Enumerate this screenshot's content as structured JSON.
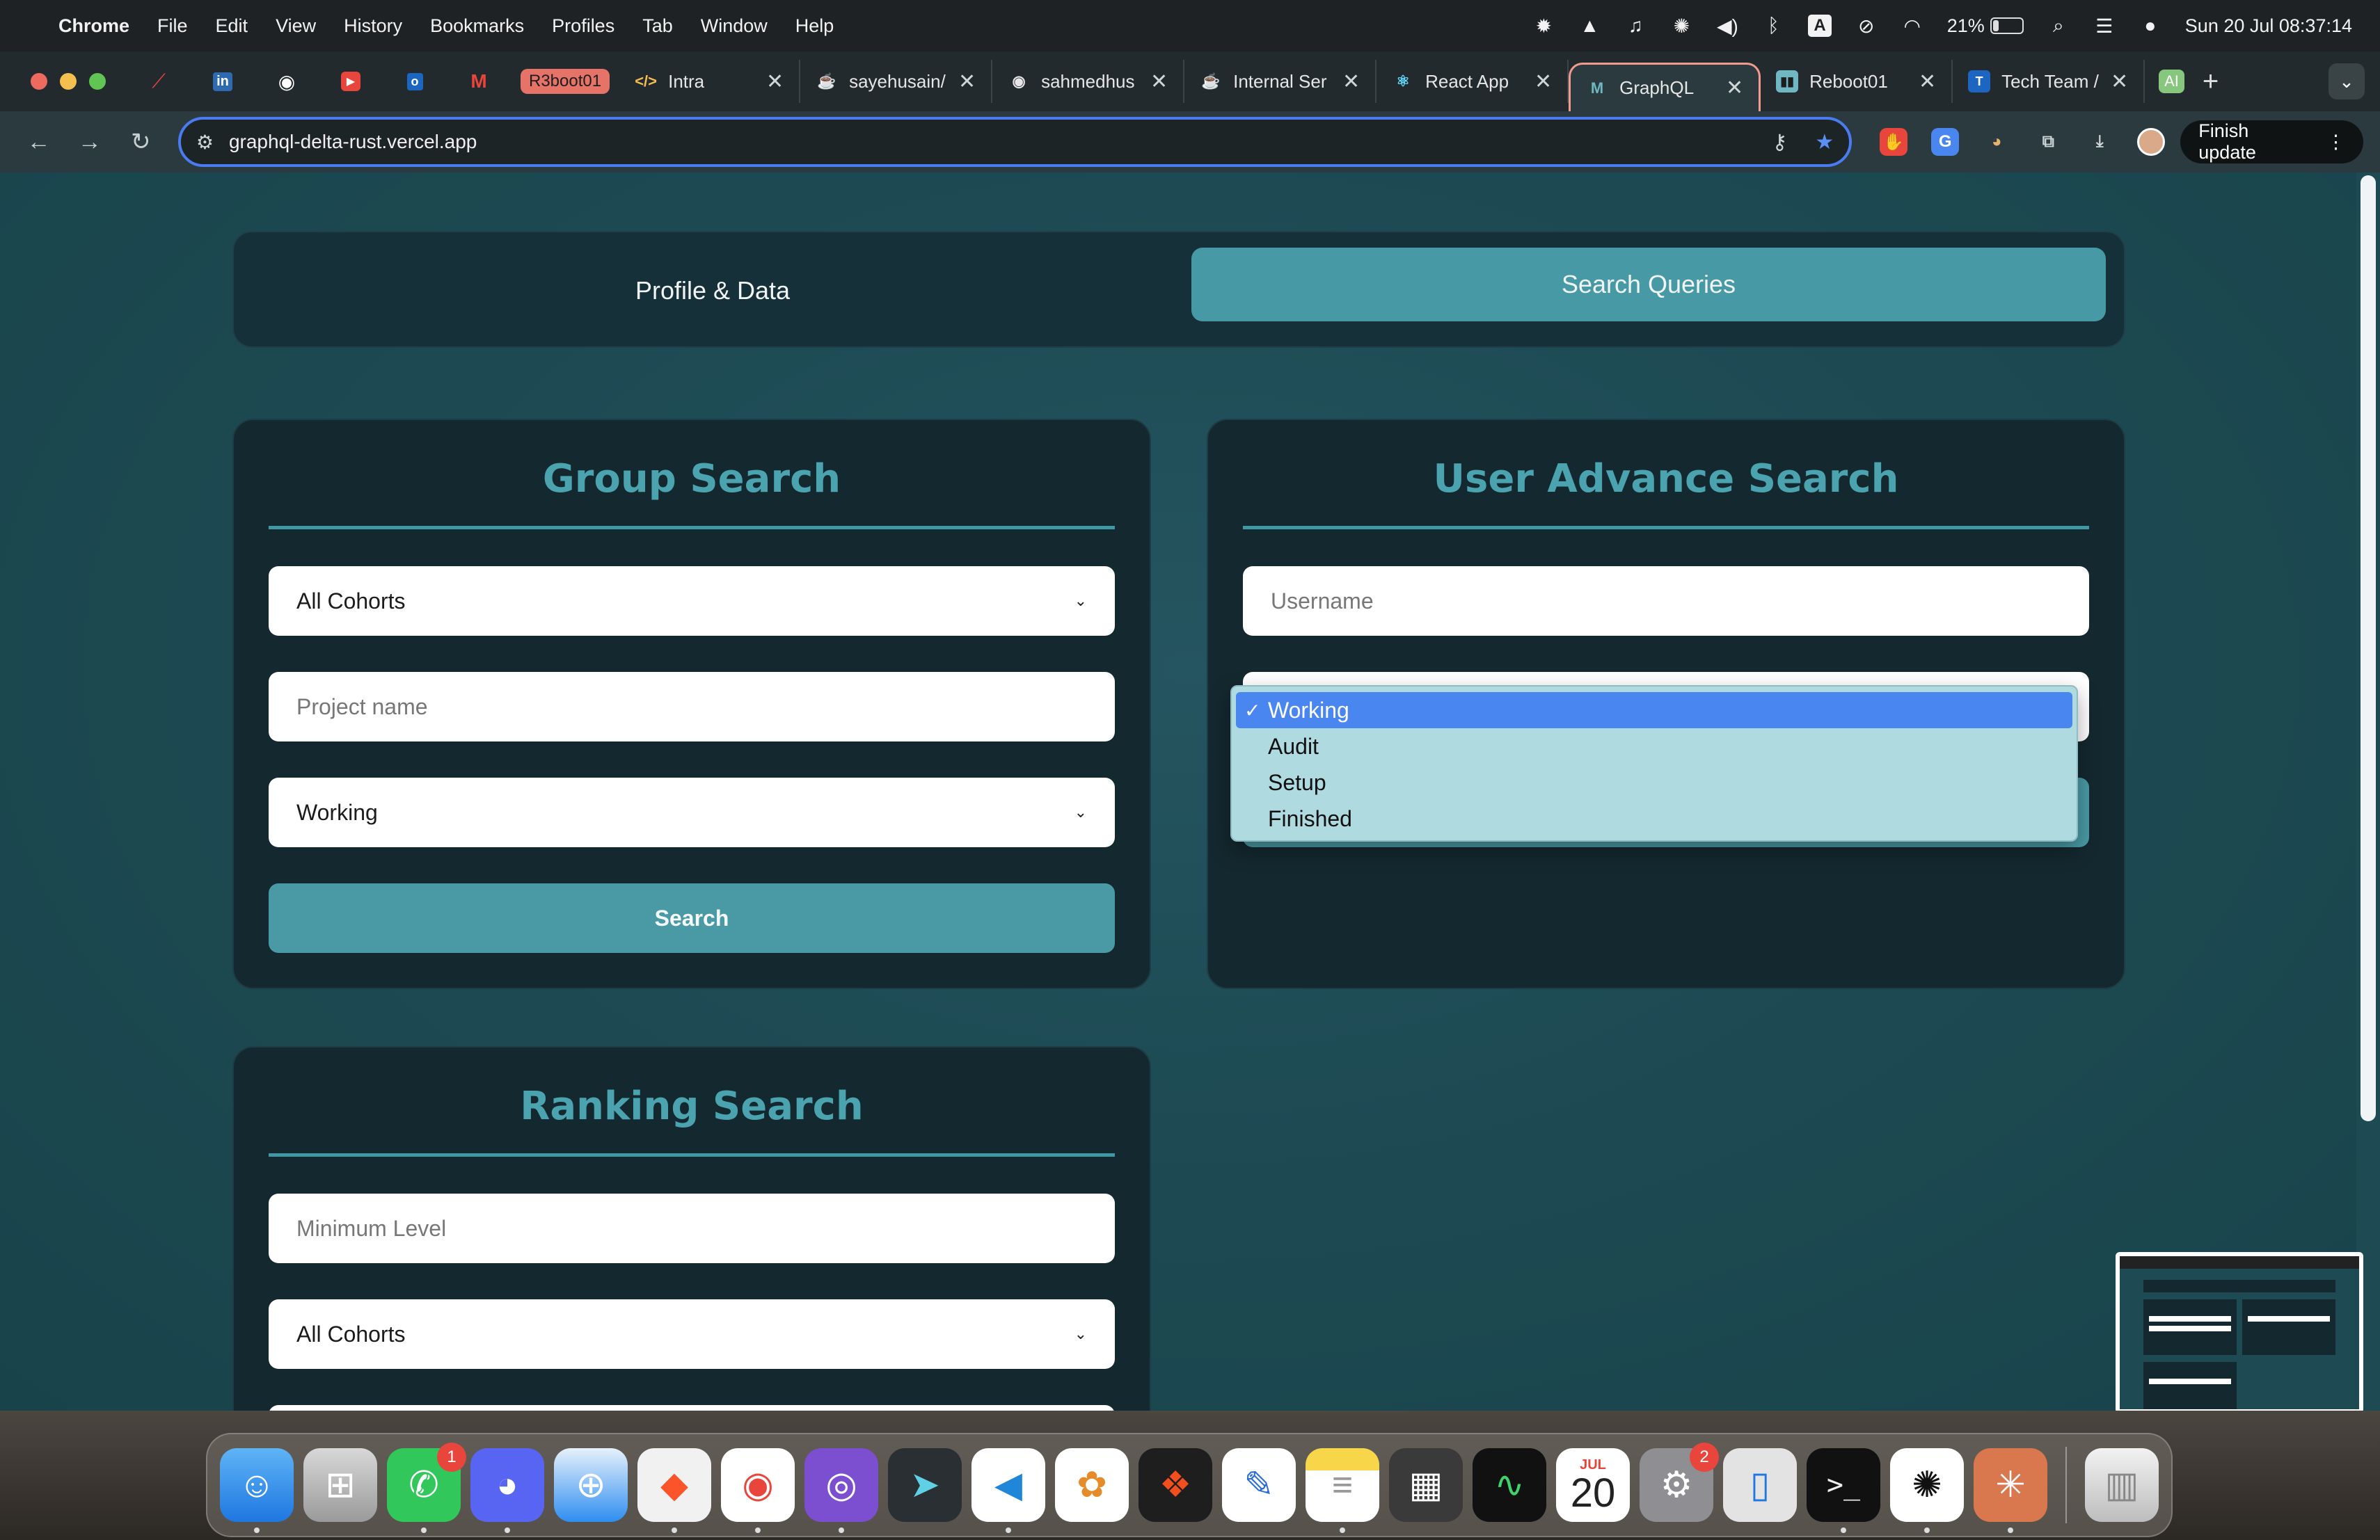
{
  "menubar": {
    "app": "Chrome",
    "items": [
      "File",
      "Edit",
      "View",
      "History",
      "Bookmarks",
      "Profiles",
      "Tab",
      "Window",
      "Help"
    ],
    "input_source": "A",
    "battery_percent": "21%",
    "battery_level": 0.21,
    "datetime": "Sun 20 Jul  08:37:14"
  },
  "tabs": {
    "group_label": "R3boot01",
    "items": [
      {
        "label": "Intra",
        "icon": "code-icon"
      },
      {
        "label": "sayehusain/",
        "icon": "gitea-icon"
      },
      {
        "label": "sahmedhus",
        "icon": "github-icon"
      },
      {
        "label": "Internal Ser",
        "icon": "gitea-icon"
      },
      {
        "label": "React App",
        "icon": "react-icon"
      },
      {
        "label": "GraphQL",
        "icon": "graphql-icon"
      },
      {
        "label": "Reboot01",
        "icon": "reboot-icon"
      },
      {
        "label": "Tech Team /",
        "icon": "teams-icon"
      }
    ],
    "active_index": 5,
    "ai_chip": "AI"
  },
  "toolbar": {
    "url": "graphql-delta-rust.vercel.app",
    "finish_update": "Finish update"
  },
  "page": {
    "tab_profile": "Profile & Data",
    "tab_search": "Search Queries",
    "group_search": {
      "title": "Group Search",
      "cohort_value": "All Cohorts",
      "project_placeholder": "Project name",
      "status_value": "Working",
      "search_button": "Search"
    },
    "user_search": {
      "title": "User Advance Search",
      "username_placeholder": "Username",
      "status_options": [
        "Working",
        "Audit",
        "Setup",
        "Finished"
      ],
      "selected_option": "Working"
    },
    "ranking_search": {
      "title": "Ranking Search",
      "min_level_placeholder": "Minimum Level",
      "cohort_value": "All Cohorts"
    }
  },
  "dock": {
    "calendar_month": "JUL",
    "calendar_day": "20",
    "whatsapp_badge": "1",
    "settings_badge": "2"
  },
  "colors": {
    "accent": "#479aa5",
    "title": "#4aa3ae",
    "card_bg": "#14282f",
    "page_bg": "#1d4a53",
    "selected_option": "#4a86f0"
  }
}
